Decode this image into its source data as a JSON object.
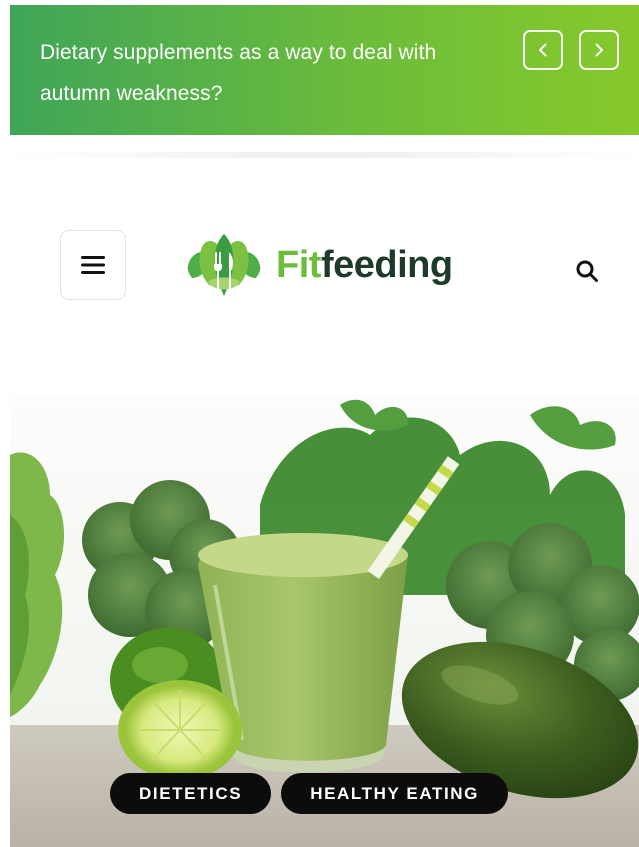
{
  "ticker": {
    "headline": "Dietary supplements as a way to deal with autumn weakness?",
    "prev_icon": "chevron-left-icon",
    "next_icon": "chevron-right-icon"
  },
  "header": {
    "menu_icon": "hamburger-menu-icon",
    "logo": {
      "part1": "Fit",
      "part2": "feeding"
    },
    "search_icon": "search-icon"
  },
  "hero": {
    "image_subject": "green smoothie with broccoli, lime, avocado and parsley",
    "tags": [
      "DIETETICS",
      "HEALTHY EATING"
    ]
  },
  "colors": {
    "ticker_gradient_start": "#3fa558",
    "ticker_gradient_end": "#86c92a",
    "logo_fit": "#6bbd3a",
    "logo_feeding": "#1e3a2a",
    "tag_bg": "#0c0c0c"
  }
}
